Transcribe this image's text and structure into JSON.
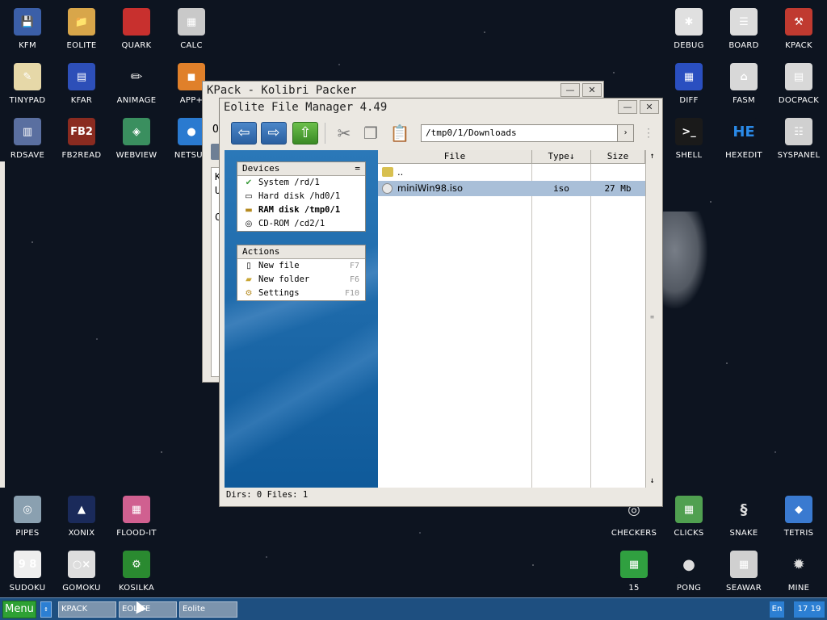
{
  "desktop": {
    "icons_left": [
      {
        "label": "KFM",
        "icon": "floppy-icon"
      },
      {
        "label": "EOLITE",
        "icon": "folder-icon"
      },
      {
        "label": "QUARK",
        "icon": "notebook-icon"
      },
      {
        "label": "CALC",
        "icon": "calculator-icon"
      },
      {
        "label": "TINYPAD",
        "icon": "notepad-icon"
      },
      {
        "label": "KFAR",
        "icon": "panels-icon"
      },
      {
        "label": "ANIMAGE",
        "icon": "brush-icon"
      },
      {
        "label": "APP+",
        "icon": "cube-icon"
      },
      {
        "label": "RDSAVE",
        "icon": "save-icon"
      },
      {
        "label": "FB2READ",
        "icon": "book-icon"
      },
      {
        "label": "WEBVIEW",
        "icon": "web-icon"
      },
      {
        "label": "NETSUR",
        "icon": "globe-icon"
      }
    ],
    "icons_right": [
      {
        "label": "DEBUG",
        "icon": "bug-icon"
      },
      {
        "label": "BOARD",
        "icon": "board-icon"
      },
      {
        "label": "KPACK",
        "icon": "hammer-icon"
      },
      {
        "label": "DIFF",
        "icon": "diff-icon"
      },
      {
        "label": "FASM",
        "icon": "fasm-icon"
      },
      {
        "label": "DOCPACK",
        "icon": "cabinet-icon"
      },
      {
        "label": "SHELL",
        "icon": "terminal-icon"
      },
      {
        "label": "HEXEDIT",
        "icon": "hex-icon"
      },
      {
        "label": "SYSPANEL",
        "icon": "sliders-icon"
      }
    ],
    "icons_bottom_left": [
      {
        "label": "PIPES",
        "icon": "pipes-icon"
      },
      {
        "label": "XONIX",
        "icon": "xonix-icon"
      },
      {
        "label": "FLOOD-IT",
        "icon": "flood-icon"
      },
      {
        "label": "SUDOKU",
        "icon": "sudoku-icon",
        "text": "9 7 8"
      },
      {
        "label": "GOMOKU",
        "icon": "gomoku-icon"
      },
      {
        "label": "KOSILKA",
        "icon": "mower-icon"
      }
    ],
    "icons_bottom_right": [
      {
        "label": "CHECKERS",
        "icon": "checkers-icon"
      },
      {
        "label": "CLICKS",
        "icon": "clicks-icon"
      },
      {
        "label": "SNAKE",
        "icon": "snake-icon"
      },
      {
        "label": "TETRIS",
        "icon": "tetris-icon"
      },
      {
        "label": "15",
        "icon": "fifteen-icon"
      },
      {
        "label": "PONG",
        "icon": "pong-icon"
      },
      {
        "label": "SEAWAR",
        "icon": "seawar-icon"
      },
      {
        "label": "MINE",
        "icon": "mine-icon"
      }
    ]
  },
  "kpack": {
    "title": "KPack - Kolibri Packer",
    "partial_texts": [
      "O",
      "K",
      "U",
      "C"
    ]
  },
  "eolite": {
    "title": "Eolite File Manager 4.49",
    "path": "/tmp0/1/Downloads",
    "devices_title": "Devices",
    "devices": [
      {
        "label": "System /rd/1",
        "icon": "system-icon",
        "bold": false
      },
      {
        "label": "Hard disk /hd0/1",
        "icon": "harddisk-icon",
        "bold": false
      },
      {
        "label": "RAM disk /tmp0/1",
        "icon": "ramdisk-icon",
        "bold": true
      },
      {
        "label": "CD-ROM /cd2/1",
        "icon": "cdrom-icon",
        "bold": false
      }
    ],
    "actions_title": "Actions",
    "actions": [
      {
        "label": "New file",
        "key": "F7",
        "icon": "new-file-icon"
      },
      {
        "label": "New folder",
        "key": "F6",
        "icon": "new-folder-icon"
      },
      {
        "label": "Settings",
        "key": "F10",
        "icon": "settings-icon"
      }
    ],
    "columns": {
      "file": "File",
      "type": "Type↓",
      "size": "Size"
    },
    "files": [
      {
        "name": "..",
        "type": "",
        "size": "",
        "icon": "folder-up-icon",
        "selected": false
      },
      {
        "name": "miniWin98.iso",
        "type": "iso",
        "size": "27 Mb",
        "icon": "disc-image-icon",
        "selected": true
      }
    ],
    "status": "Dirs: 0  Files: 1"
  },
  "taskbar": {
    "menu": "Menu",
    "tasks": [
      "KPACK",
      "EOLITE",
      "Eolite"
    ],
    "lang": "En",
    "clock": "17 19"
  },
  "colors": {
    "desktop_bg": "#0d1420",
    "taskbar": "#1e4f80",
    "menu_button": "#2ea134",
    "panel_blue": "#1a68a8",
    "selection": "#a9bfd8"
  }
}
